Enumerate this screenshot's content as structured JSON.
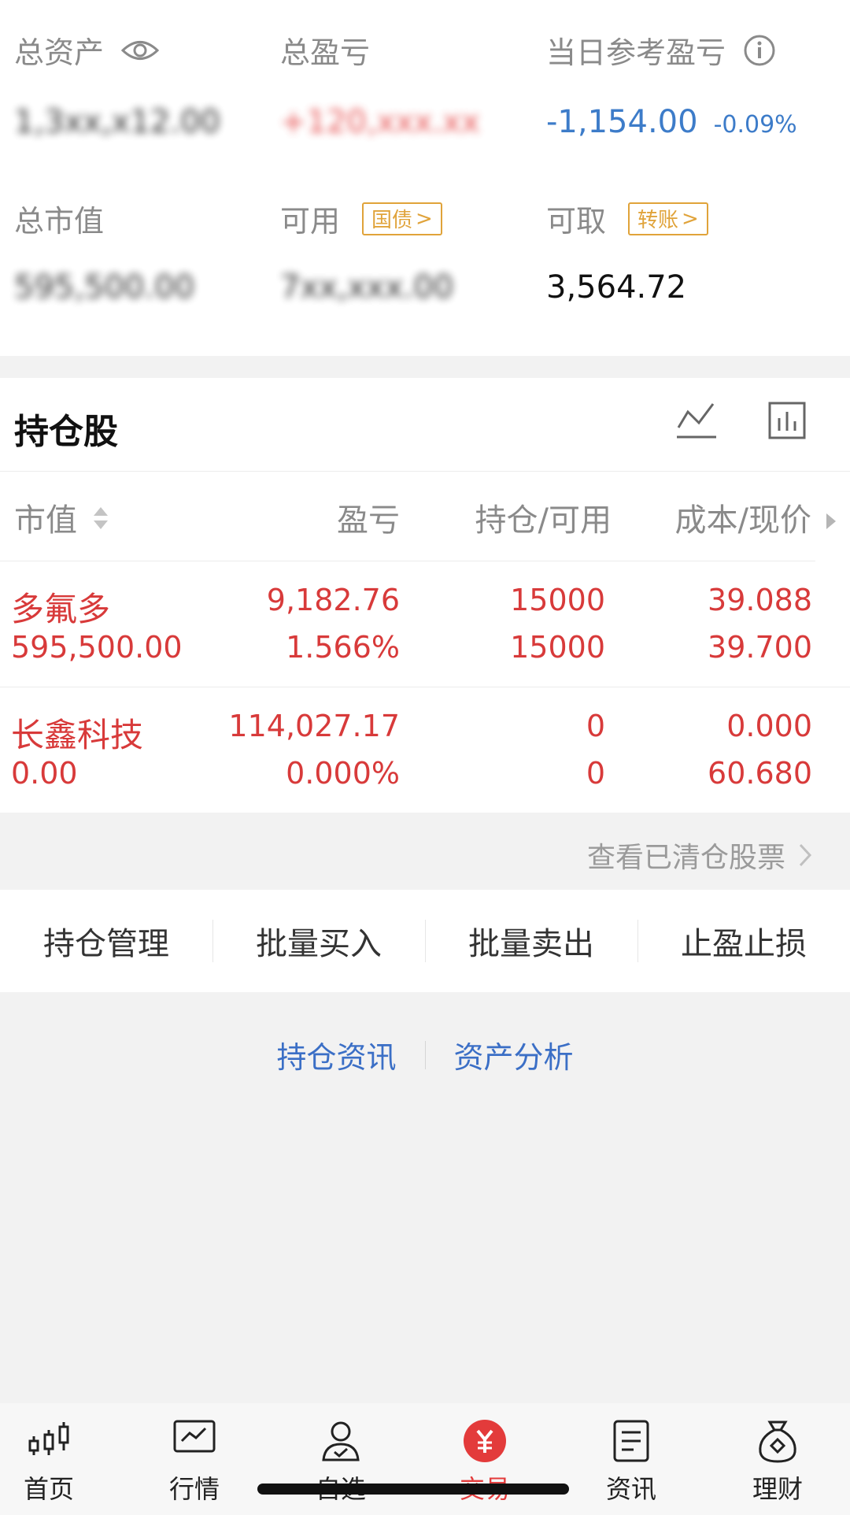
{
  "summary": {
    "total_assets_label": "总资产",
    "total_assets_value": "1,3xx,x12.00",
    "total_pnl_label": "总盈亏",
    "total_pnl_value": "+120,xxx.xx",
    "daily_ref_pnl_label": "当日参考盈亏",
    "daily_ref_pnl_value": "-1,154.00",
    "daily_ref_pnl_pct": "-0.09%",
    "market_value_label": "总市值",
    "market_value_value": "595,500.00",
    "available_label": "可用",
    "available_value": "7xx,xxx.00",
    "treasury_btn": "国债",
    "withdrawable_label": "可取",
    "withdrawable_value": "3,564.72",
    "transfer_btn": "转账"
  },
  "holdings": {
    "title": "持仓股",
    "headers": {
      "market_value": "市值",
      "pnl": "盈亏",
      "position": "持仓/可用",
      "cost_price": "成本/现价"
    },
    "rows": [
      {
        "name": "多氟多",
        "market_value": "595,500.00",
        "pnl": "9,182.76",
        "pnl_pct": "1.566%",
        "position": "15000",
        "available": "15000",
        "cost": "39.088",
        "price": "39.700"
      },
      {
        "name": "长鑫科技",
        "market_value": "0.00",
        "pnl": "114,027.17",
        "pnl_pct": "0.000%",
        "position": "0",
        "available": "0",
        "cost": "0.000",
        "price": "60.680"
      }
    ]
  },
  "cleared_link": "查看已清仓股票",
  "actions": [
    "持仓管理",
    "批量买入",
    "批量卖出",
    "止盈止损"
  ],
  "links": {
    "news": "持仓资讯",
    "analysis": "资产分析"
  },
  "nav": [
    {
      "label": "首页",
      "icon": "candlestick-icon"
    },
    {
      "label": "行情",
      "icon": "market-chart-icon"
    },
    {
      "label": "自选",
      "icon": "user-star-icon"
    },
    {
      "label": "交易",
      "icon": "yuan-icon"
    },
    {
      "label": "资讯",
      "icon": "document-icon"
    },
    {
      "label": "理财",
      "icon": "money-bag-icon"
    }
  ],
  "colors": {
    "red": "#e33b3b",
    "blue": "#3d7cc9",
    "gold": "#e0a33a"
  }
}
